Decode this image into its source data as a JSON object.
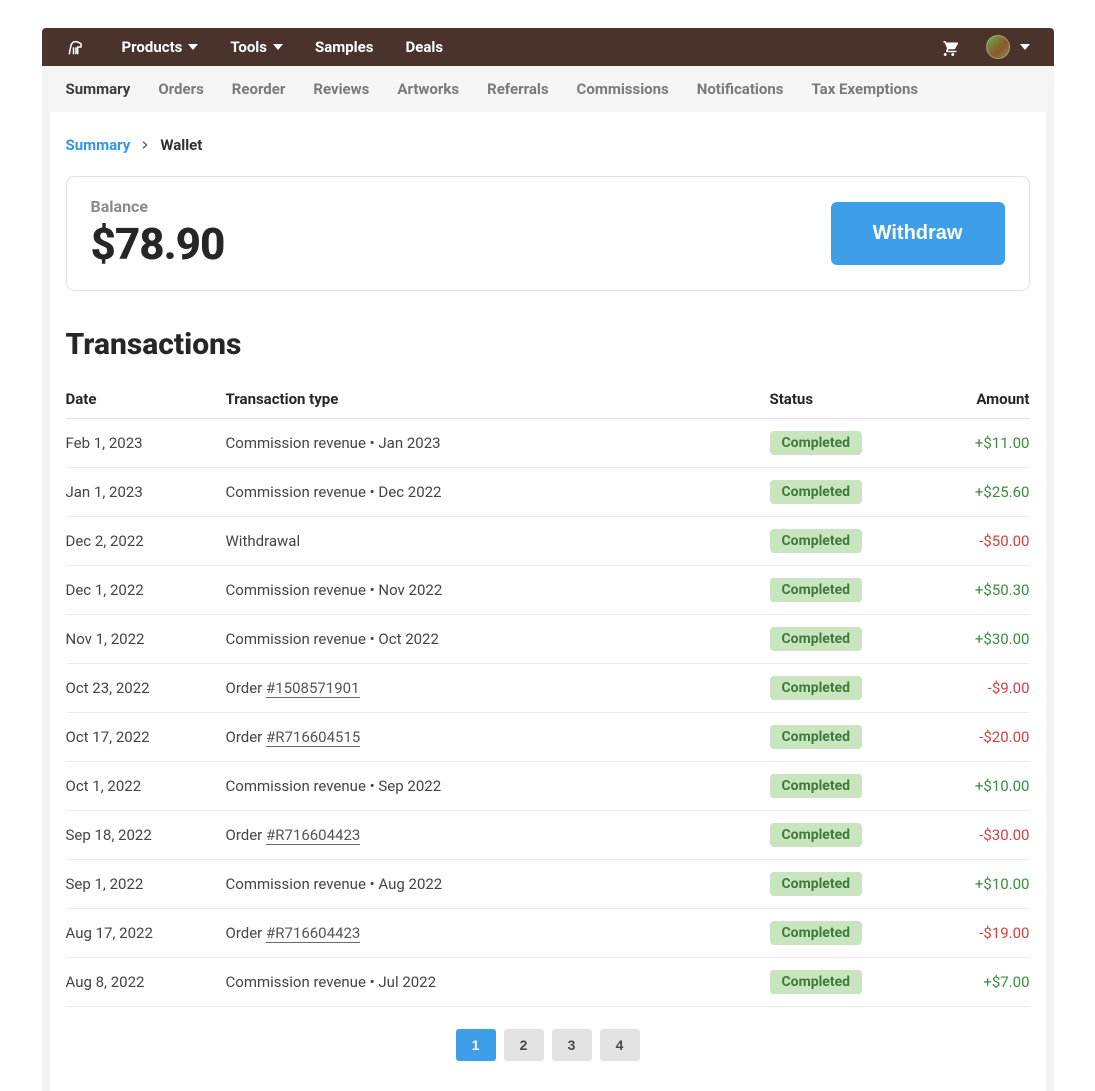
{
  "topnav": {
    "items": [
      {
        "label": "Products",
        "dropdown": true
      },
      {
        "label": "Tools",
        "dropdown": true
      },
      {
        "label": "Samples",
        "dropdown": false
      },
      {
        "label": "Deals",
        "dropdown": false
      }
    ]
  },
  "subnav": {
    "items": [
      {
        "label": "Summary",
        "active": true
      },
      {
        "label": "Orders"
      },
      {
        "label": "Reorder"
      },
      {
        "label": "Reviews"
      },
      {
        "label": "Artworks"
      },
      {
        "label": "Referrals"
      },
      {
        "label": "Commissions"
      },
      {
        "label": "Notifications"
      },
      {
        "label": "Tax Exemptions"
      }
    ]
  },
  "breadcrumb": {
    "link": "Summary",
    "current": "Wallet"
  },
  "balance": {
    "label": "Balance",
    "amount": "$78.90",
    "withdraw_label": "Withdraw"
  },
  "transactions": {
    "title": "Transactions",
    "headers": {
      "date": "Date",
      "type": "Transaction type",
      "status": "Status",
      "amount": "Amount"
    },
    "rows": [
      {
        "date": "Feb 1, 2023",
        "type_text": "Commission revenue • Jan 2023",
        "order_link": null,
        "status": "Completed",
        "amount": "+$11.00",
        "dir": "pos"
      },
      {
        "date": "Jan 1, 2023",
        "type_text": "Commission revenue • Dec 2022",
        "order_link": null,
        "status": "Completed",
        "amount": "+$25.60",
        "dir": "pos"
      },
      {
        "date": "Dec 2, 2022",
        "type_text": "Withdrawal",
        "order_link": null,
        "status": "Completed",
        "amount": "-$50.00",
        "dir": "neg"
      },
      {
        "date": "Dec 1, 2022",
        "type_text": "Commission revenue • Nov 2022",
        "order_link": null,
        "status": "Completed",
        "amount": "+$50.30",
        "dir": "pos"
      },
      {
        "date": "Nov 1, 2022",
        "type_text": "Commission revenue • Oct 2022",
        "order_link": null,
        "status": "Completed",
        "amount": "+$30.00",
        "dir": "pos"
      },
      {
        "date": "Oct 23, 2022",
        "type_text": "Order ",
        "order_link": "#1508571901",
        "status": "Completed",
        "amount": "-$9.00",
        "dir": "neg"
      },
      {
        "date": "Oct 17, 2022",
        "type_text": "Order ",
        "order_link": "#R716604515",
        "status": "Completed",
        "amount": "-$20.00",
        "dir": "neg"
      },
      {
        "date": "Oct 1, 2022",
        "type_text": "Commission revenue • Sep 2022",
        "order_link": null,
        "status": "Completed",
        "amount": "+$10.00",
        "dir": "pos"
      },
      {
        "date": "Sep 18, 2022",
        "type_text": "Order ",
        "order_link": "#R716604423",
        "status": "Completed",
        "amount": "-$30.00",
        "dir": "neg"
      },
      {
        "date": "Sep 1, 2022",
        "type_text": "Commission revenue • Aug 2022",
        "order_link": null,
        "status": "Completed",
        "amount": "+$10.00",
        "dir": "pos"
      },
      {
        "date": "Aug 17, 2022",
        "type_text": "Order ",
        "order_link": "#R716604423",
        "status": "Completed",
        "amount": "-$19.00",
        "dir": "neg"
      },
      {
        "date": "Aug 8, 2022",
        "type_text": "Commission revenue • Jul 2022",
        "order_link": null,
        "status": "Completed",
        "amount": "+$7.00",
        "dir": "pos"
      }
    ]
  },
  "pagination": {
    "pages": [
      "1",
      "2",
      "3",
      "4"
    ],
    "active": "1"
  }
}
